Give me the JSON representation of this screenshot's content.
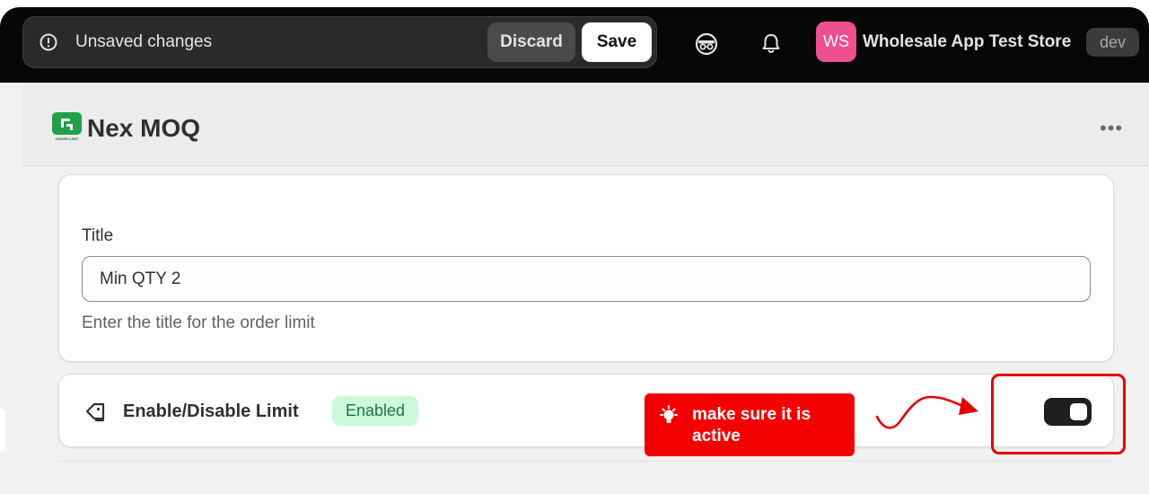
{
  "topbar": {
    "unsaved_text": "Unsaved changes",
    "discard_label": "Discard",
    "save_label": "Save",
    "avatar_initials": "WS",
    "store_name": "Wholesale App Test Store",
    "env_badge": "dev",
    "icons": [
      "alert-circle-icon",
      "incognito-icon",
      "bell-icon"
    ]
  },
  "header": {
    "app_title": "Nex MOQ",
    "app_logo_text": "ORDER LIMIT",
    "more_label": "•••"
  },
  "title_card": {
    "label": "Title",
    "value": "Min QTY 2",
    "help_text": "Enter the title for the order limit"
  },
  "limit_card": {
    "label": "Enable/Disable Limit",
    "status": "Enabled",
    "toggle_on": true
  },
  "annotation": {
    "text": "make sure it is active",
    "color": "#f40000"
  },
  "colors": {
    "topbar_bg": "#070707",
    "avatar_bg": "#ee4f8f",
    "badge_bg": "#cdf8da",
    "badge_text": "#1a7443",
    "accent_red": "#e30000"
  }
}
